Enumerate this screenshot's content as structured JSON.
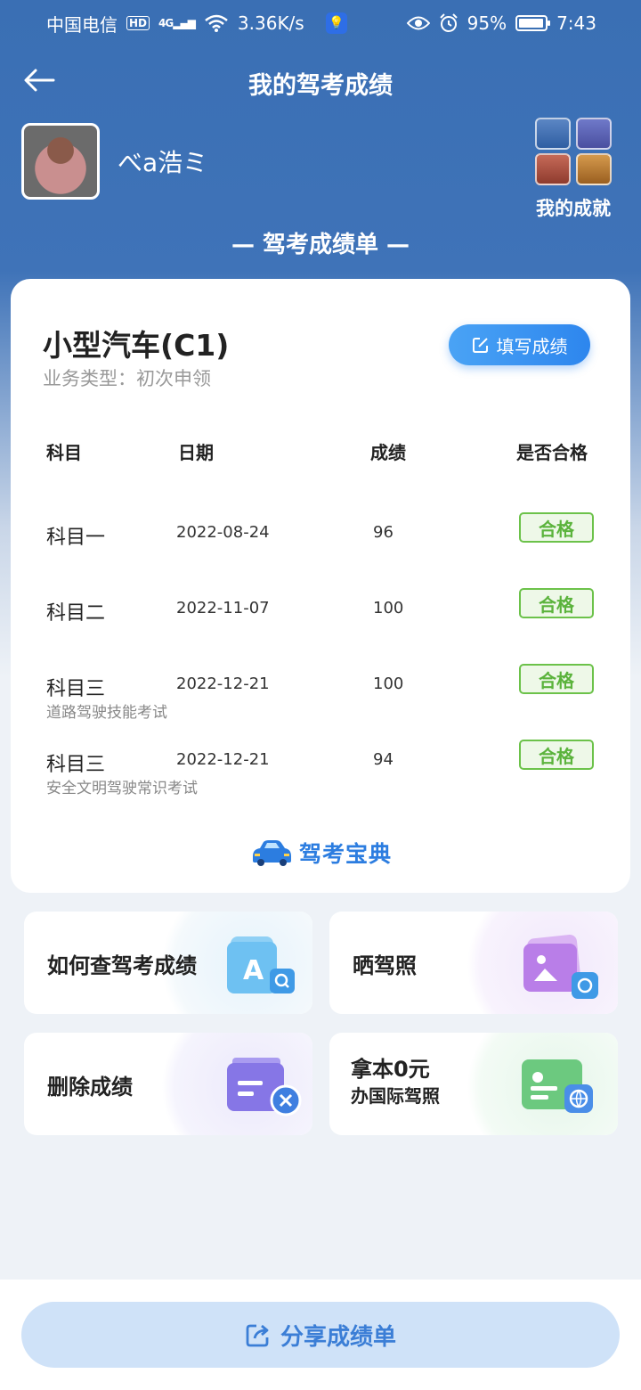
{
  "status_bar": {
    "carrier": "中国电信",
    "hd": "HD",
    "network": "4G",
    "speed": "3.36K/s",
    "battery": "95%",
    "battery_level": 0.95,
    "time": "7:43"
  },
  "header": {
    "title": "我的驾考成绩"
  },
  "profile": {
    "username": "べa浩ミ"
  },
  "achievements": {
    "label": "我的成就"
  },
  "section_title": "— 驾考成绩单 —",
  "card": {
    "license": "小型汽车(C1)",
    "business_type": "业务类型：初次申领",
    "fill_button": "填写成绩",
    "columns": [
      "科目",
      "日期",
      "成绩",
      "是否合格"
    ],
    "rows": [
      {
        "subject": "科目一",
        "sub": "",
        "date": "2022-08-24",
        "score": "96",
        "result": "合格"
      },
      {
        "subject": "科目二",
        "sub": "",
        "date": "2022-11-07",
        "score": "100",
        "result": "合格"
      },
      {
        "subject": "科目三",
        "sub": "道路驾驶技能考试",
        "date": "2022-12-21",
        "score": "100",
        "result": "合格"
      },
      {
        "subject": "科目三",
        "sub": "安全文明驾驶常识考试",
        "date": "2022-12-21",
        "score": "94",
        "result": "合格"
      }
    ],
    "brand": "驾考宝典"
  },
  "tiles": {
    "query": "如何查驾考成绩",
    "show_license": "晒驾照",
    "delete": "删除成绩",
    "intl_line1": "拿本0元",
    "intl_line2": "办国际驾照"
  },
  "share_button": "分享成绩单",
  "colors": {
    "header_blue": "#3f73b8",
    "accent_blue": "#2d86ee",
    "pass_green": "#5bb33c"
  }
}
